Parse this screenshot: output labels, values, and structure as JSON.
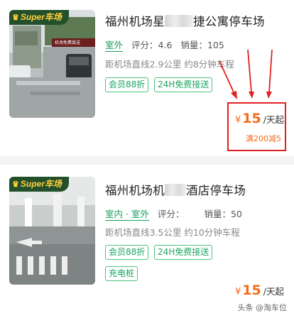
{
  "listings": [
    {
      "badge": "Super车场",
      "title_left": "福州机场星",
      "title_right": "捷公寓停车场",
      "location": "室外",
      "rating_label": "评分：",
      "rating_value": "4.6",
      "sales_label": "销量：",
      "sales_value": "105",
      "distance": "距机场直线2.9公里 约8分钟车程",
      "tags": [
        "会员88折",
        "24H免费接送"
      ],
      "currency": "¥",
      "price": "15",
      "price_unit": "/天起",
      "promo": "满200减5",
      "photo_sign": "机场免费接送"
    },
    {
      "badge": "Super车场",
      "title_left": "福州机场机",
      "title_right": "酒店停车场",
      "location": "室内 · 室外",
      "rating_label": "评分：",
      "rating_value": "",
      "sales_label": "销量：",
      "sales_value": "50",
      "distance": "距机场直线3.5公里 约10分钟车程",
      "tags": [
        "会员88折",
        "24H免费接送",
        "充电桩"
      ],
      "currency": "¥",
      "price": "15",
      "price_unit": "/天起"
    }
  ],
  "watermark": "头条 @淘车位",
  "colors": {
    "accent_green": "#1aa65e",
    "price_orange": "#f26a18",
    "badge_bg": "#234f2b",
    "badge_text": "#ffd23f",
    "annotation_red": "#e02020"
  },
  "icons": [
    "crown-icon",
    "annotation-arrow-icon"
  ]
}
